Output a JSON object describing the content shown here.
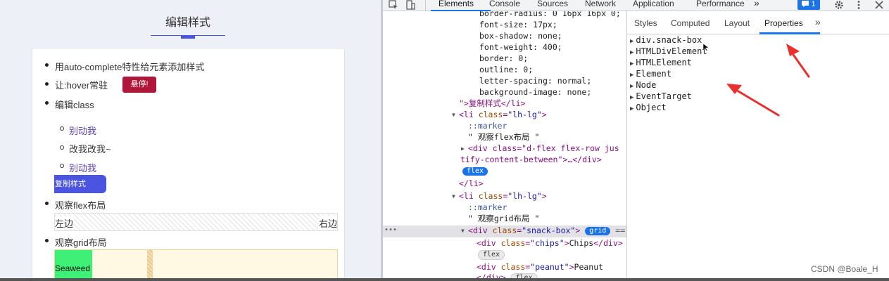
{
  "left_page": {
    "title": "编辑样式",
    "items": {
      "autocomplete": "用auto-complete特性给元素添加样式",
      "hover": "让:hover常驻",
      "hover_button": "悬停!",
      "edit_class": "编辑class",
      "sub1": "别动我",
      "sub2": "改我改我~",
      "sub3": "别动我",
      "copy_button": "复制样式",
      "flex_label": "观察flex布局",
      "flex_left": "左边",
      "flex_right": "右边",
      "grid_label": "观察grid布局",
      "grid_cell": "Seaweed"
    }
  },
  "devtools": {
    "tabs": [
      "Elements",
      "Console",
      "Sources",
      "Network",
      "Application",
      "Performance"
    ],
    "more": "»",
    "issues_count": "1",
    "elements": {
      "css1": "border-radius: 0 16px 16px 0;",
      "css2": "font-size: 17px;",
      "css3": "box-shadow: none;",
      "css4": "font-weight: 400;",
      "css5": "border: 0;",
      "css6": "outline: 0;",
      "css7": "letter-spacing: normal;",
      "css8": "background-image: none;",
      "close_li": "\">复制样式</li>",
      "li1_tag": "li",
      "li_attr": "class",
      "li_val": "\"lh-lg\"",
      "marker": "::marker",
      "text_flex": "\" 观察flex布局 \"",
      "div_flex_a": "<div class=\"d-flex flex-row jus",
      "div_flex_b": "tify-content-between\">…</div>",
      "pill_flex": "flex",
      "close_li2": "</li>",
      "text_grid": "\" 观察grid布局 \"",
      "snack_val": "\"snack-box\"",
      "pill_grid": "grid",
      "eq": "==",
      "chips_val": "\"chips\"",
      "chips_text": "Chips",
      "peanut_val": "\"peanut\"",
      "peanut_text": "Peanut",
      "close_div": "</div>"
    },
    "subtabs": [
      "Styles",
      "Computed",
      "Layout",
      "Properties"
    ],
    "subtabs_more": "»",
    "properties": [
      "div.snack-box",
      "HTMLDivElement",
      "HTMLElement",
      "Element",
      "Node",
      "EventTarget",
      "Object"
    ],
    "watermark": "CSDN @Boale_H",
    "accent": "#1a73e8",
    "arrow_color": "#e8312e"
  }
}
